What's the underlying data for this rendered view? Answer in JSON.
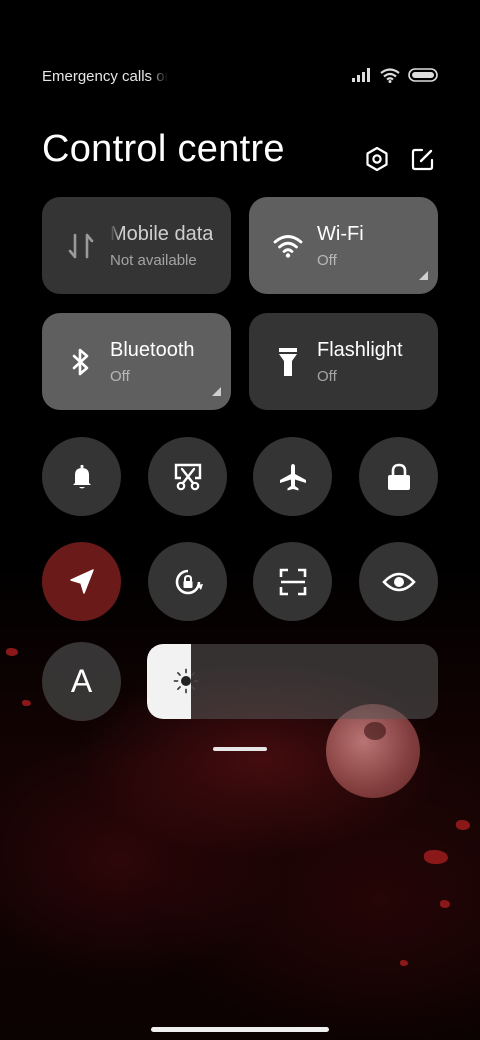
{
  "status_bar": {
    "carrier_text": "Emergency calls only",
    "icons": [
      "signal-icon",
      "wifi-icon",
      "battery-icon"
    ]
  },
  "header": {
    "title": "Control centre",
    "buttons": [
      "settings-icon",
      "edit-icon"
    ]
  },
  "tiles": [
    {
      "name": "Mobile data",
      "status": "Not available",
      "icon": "mobile-data-icon",
      "active": false
    },
    {
      "name": "Wi-Fi",
      "status": "Off",
      "icon": "wifi-icon",
      "active": true
    },
    {
      "name": "Bluetooth",
      "status": "Off",
      "icon": "bluetooth-icon",
      "active": true
    },
    {
      "name": "Flashlight",
      "status": "Off",
      "icon": "flashlight-icon",
      "active": false
    }
  ],
  "toggles_row1": [
    "bell-icon",
    "screenshot-icon",
    "airplane-icon",
    "lock-icon"
  ],
  "toggles_row2": [
    "location-icon",
    "rotation-lock-icon",
    "scanner-icon",
    "eye-icon"
  ],
  "auto_brightness_label": "A",
  "brightness": {
    "level": 0.15,
    "icon": "brightness-icon"
  },
  "colors": {
    "accent_red": "#6b1a1a",
    "tile": "#464646",
    "tile_active": "#696969"
  }
}
